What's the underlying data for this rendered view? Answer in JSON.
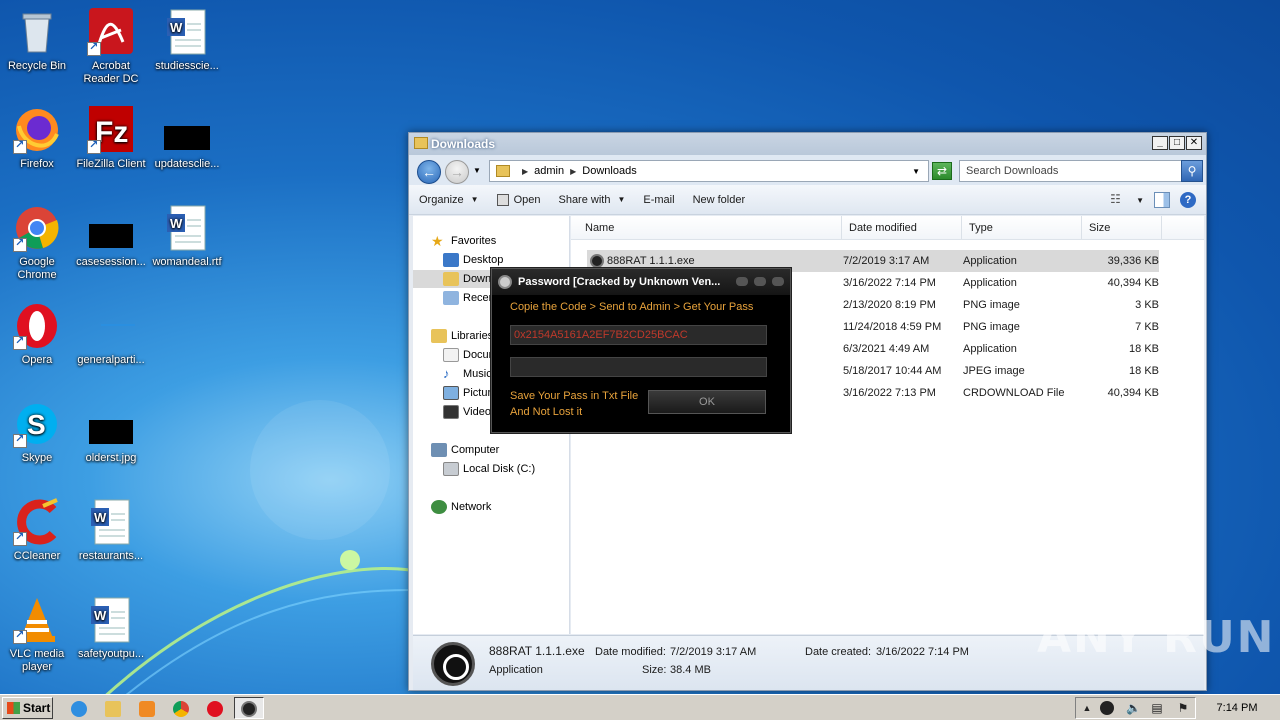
{
  "desktop": {
    "icons": [
      {
        "label": "Recycle Bin"
      },
      {
        "label": "Acrobat Reader DC"
      },
      {
        "label": "studiesscie..."
      },
      {
        "label": "Firefox"
      },
      {
        "label": "FileZilla Client"
      },
      {
        "label": "updatesclie..."
      },
      {
        "label": "Google Chrome"
      },
      {
        "label": "casesession..."
      },
      {
        "label": "womandeal.rtf"
      },
      {
        "label": "Opera"
      },
      {
        "label": "generalparti..."
      },
      {
        "label": "Skype"
      },
      {
        "label": "olderst.jpg"
      },
      {
        "label": "CCleaner"
      },
      {
        "label": "restaurants..."
      },
      {
        "label": "VLC media player"
      },
      {
        "label": "safetyoutpu..."
      }
    ]
  },
  "explorer": {
    "title": "Downloads",
    "breadcrumb": [
      "admin",
      "Downloads"
    ],
    "search_placeholder": "Search Downloads",
    "toolbar": {
      "organize": "Organize",
      "open": "Open",
      "share_with": "Share with",
      "email": "E-mail",
      "new_folder": "New folder"
    },
    "nav": {
      "favorites": "Favorites",
      "desktop": "Desktop",
      "downloads": "Downloads",
      "recent": "Recent Places",
      "libraries": "Libraries",
      "documents": "Documents",
      "music": "Music",
      "pictures": "Pictures",
      "videos": "Videos",
      "computer": "Computer",
      "local_disk": "Local Disk (C:)",
      "network": "Network"
    },
    "columns": [
      "Name",
      "Date modified",
      "Type",
      "Size"
    ],
    "files": [
      {
        "name": "888RAT 1.1.1.exe",
        "date": "7/2/2019 3:17 AM",
        "type": "Application",
        "size": "39,336 KB"
      },
      {
        "name": "",
        "date": "3/16/2022 7:14 PM",
        "type": "Application",
        "size": "40,394 KB"
      },
      {
        "name": "",
        "date": "2/13/2020 8:19 PM",
        "type": "PNG image",
        "size": "3 KB"
      },
      {
        "name": "",
        "date": "11/24/2018 4:59 PM",
        "type": "PNG image",
        "size": "7 KB"
      },
      {
        "name": "",
        "date": "6/3/2021 4:49 AM",
        "type": "Application",
        "size": "18 KB"
      },
      {
        "name": "",
        "date": "5/18/2017 10:44 AM",
        "type": "JPEG image",
        "size": "18 KB"
      },
      {
        "name": "",
        "date": "3/16/2022 7:13 PM",
        "type": "CRDOWNLOAD File",
        "size": "40,394 KB"
      }
    ],
    "details": {
      "name": "888RAT 1.1.1.exe",
      "modified_label": "Date modified:",
      "modified": "7/2/2019 3:17 AM",
      "created_label": "Date created:",
      "created": "3/16/2022 7:14 PM",
      "type": "Application",
      "size_label": "Size:",
      "size": "38.4 MB"
    }
  },
  "dialog": {
    "title": "Password [Cracked by Unknown Ven...",
    "instruction": "Copie the Code > Send to Admin > Get Your Pass",
    "code": "0x2154A5161A2EF7B2CD25BCAC",
    "password_value": "",
    "note": "Save Your Pass in Txt File And Not Lost it",
    "ok": "OK"
  },
  "taskbar": {
    "start": "Start",
    "clock": "7:14 PM"
  },
  "watermark": "ANY RUN"
}
